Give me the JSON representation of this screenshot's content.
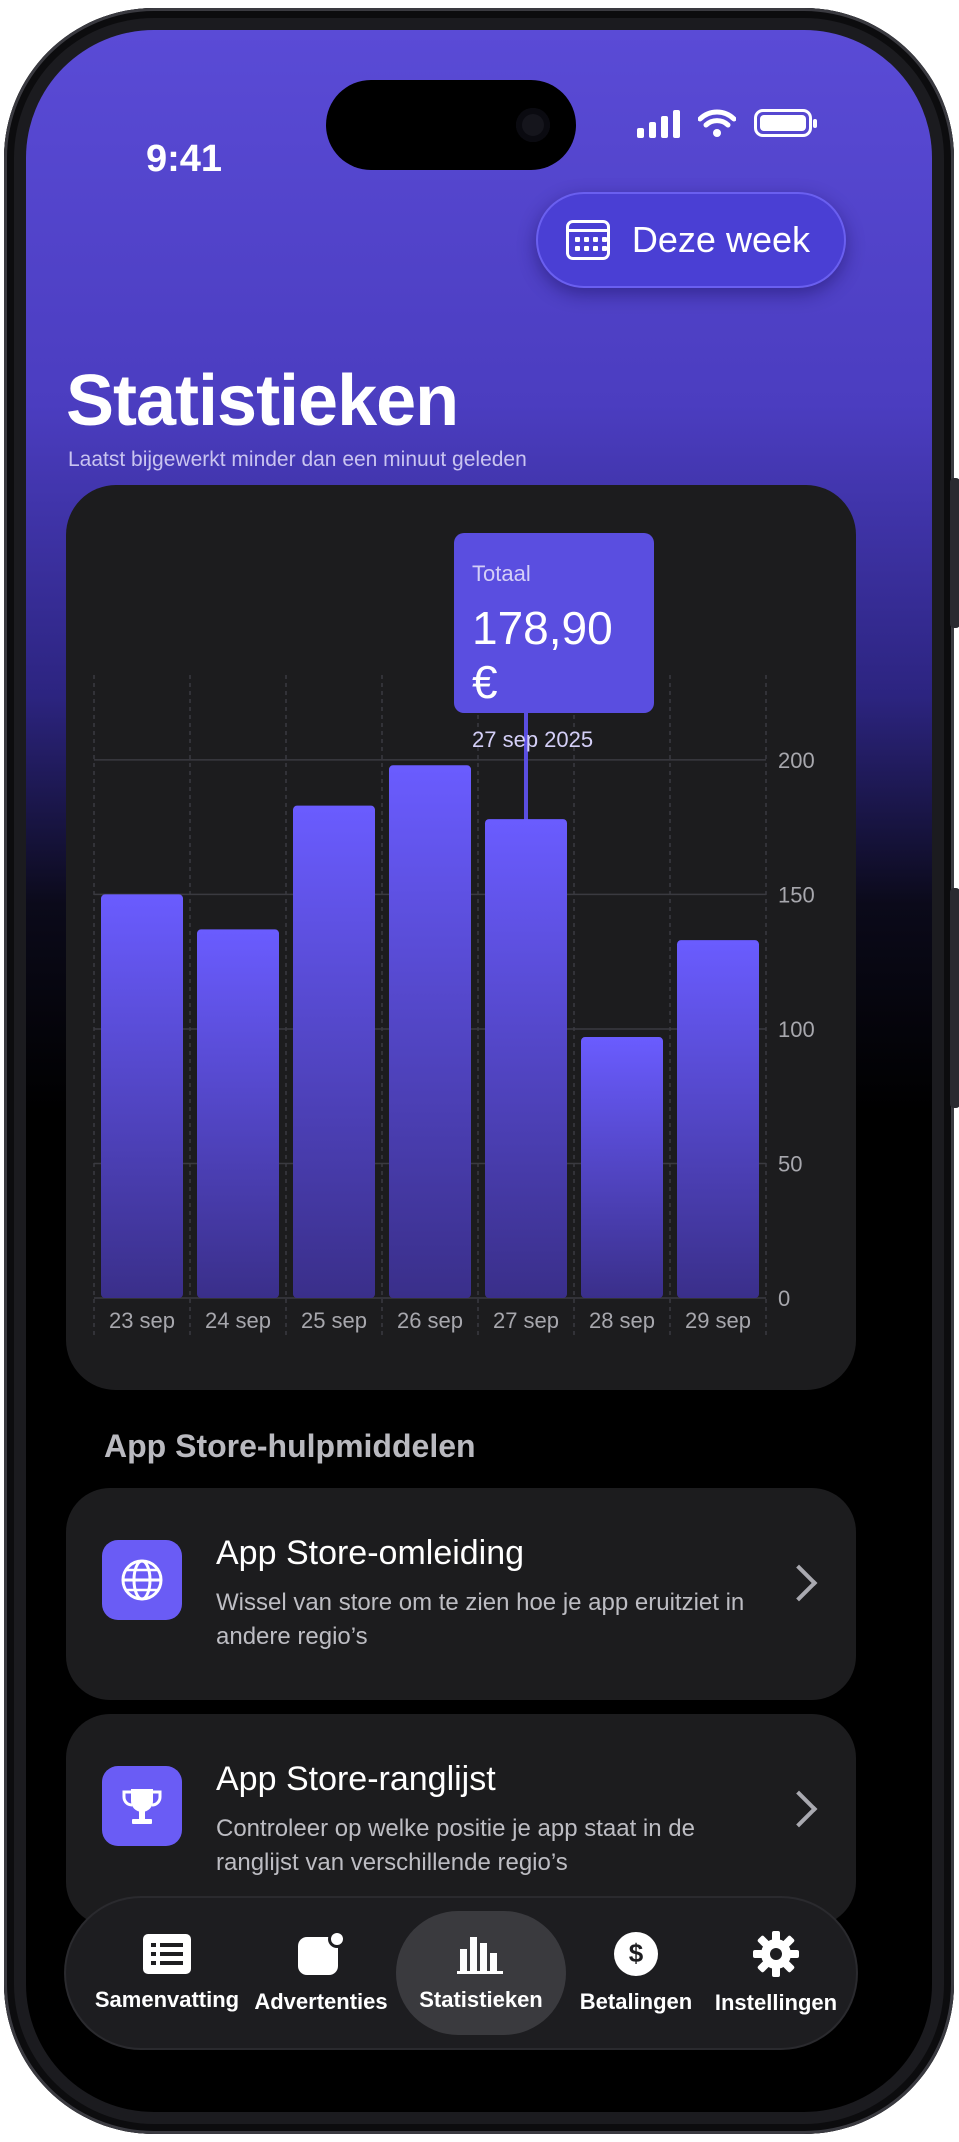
{
  "status_bar": {
    "time": "9:41"
  },
  "header": {
    "week_button": "Deze week",
    "title": "Statistieken",
    "subtitle": "Laatst bijgewerkt minder dan een minuut geleden"
  },
  "tooltip": {
    "label": "Totaal",
    "value": "178,90 €",
    "date": "27 sep 2025"
  },
  "chart_data": {
    "type": "bar",
    "categories": [
      "23 sep",
      "24 sep",
      "25 sep",
      "26 sep",
      "27 sep",
      "28 sep",
      "29 sep"
    ],
    "values": [
      150,
      137,
      183,
      198,
      178,
      97,
      133
    ],
    "y_ticks": [
      "0",
      "50",
      "100",
      "150",
      "200"
    ],
    "ylim": [
      0,
      210
    ],
    "highlighted_index": 4,
    "bar_color": "#6a5cff",
    "grid": true,
    "y_axis_position": "right"
  },
  "tools": {
    "section_title": "App Store-hulpmiddelen",
    "items": [
      {
        "title": "App Store-omleiding",
        "description": "Wissel van store om te zien hoe je app eruitziet in andere regio’s",
        "icon": "globe-icon"
      },
      {
        "title": "App Store-ranglijst",
        "description": "Controleer op welke positie je app staat in de ranglijst van verschillende regio’s",
        "icon": "trophy-icon"
      }
    ]
  },
  "tabbar": {
    "items": [
      {
        "label": "Samenvatting",
        "icon": "list-icon",
        "active": false
      },
      {
        "label": "Advertenties",
        "icon": "ad-notification-icon",
        "active": false
      },
      {
        "label": "Statistieken",
        "icon": "bar-chart-icon",
        "active": true
      },
      {
        "label": "Betalingen",
        "icon": "dollar-icon",
        "active": false
      },
      {
        "label": "Instellingen",
        "icon": "gear-icon",
        "active": false
      }
    ]
  },
  "colors": {
    "accent": "#5a4ee0",
    "header_gradient_top": "#5a4bd6",
    "card_background": "#1c1c1e"
  }
}
